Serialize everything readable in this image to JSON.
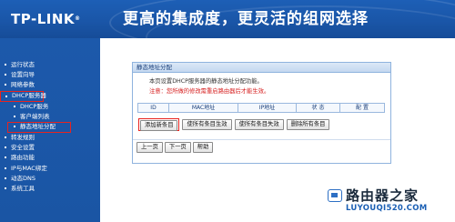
{
  "header": {
    "logo": "TP-LINK",
    "logo_mark": "®",
    "slogan": "更高的集成度，更灵活的组网选择"
  },
  "sidebar": {
    "items": [
      {
        "label": "运行状态"
      },
      {
        "label": "设置向导"
      },
      {
        "label": "网络参数"
      },
      {
        "label": "DHCP服务器"
      },
      {
        "label": "DHCP服务"
      },
      {
        "label": "客户端列表"
      },
      {
        "label": "静态地址分配"
      },
      {
        "label": "转发规则"
      },
      {
        "label": "安全设置"
      },
      {
        "label": "路由功能"
      },
      {
        "label": "IP与MAC绑定"
      },
      {
        "label": "动态DNS"
      },
      {
        "label": "系统工具"
      }
    ]
  },
  "panel": {
    "title": "静态地址分配",
    "description": "本页设置DHCP服务器的静态地址分配功能。",
    "notice": "注意：您所做的修改需重启路由器后才能生效。",
    "table_headers": [
      "ID",
      "MAC地址",
      "IP地址",
      "状 态",
      "配 置"
    ],
    "buttons": {
      "add": "添加新条目",
      "enable_all": "使所有条目生效",
      "disable_all": "使所有条目失效",
      "delete_all": "删除所有条目"
    },
    "footer": {
      "prev": "上一页",
      "next": "下一页",
      "help": "帮助"
    }
  },
  "watermark": {
    "title": "路由器之家",
    "url": "LUYOUQI520.COM"
  },
  "colors": {
    "banner": "#1a56a8",
    "sidebar": "#1a55a4",
    "highlight_border": "#e8241f",
    "notice": "#d62020"
  }
}
